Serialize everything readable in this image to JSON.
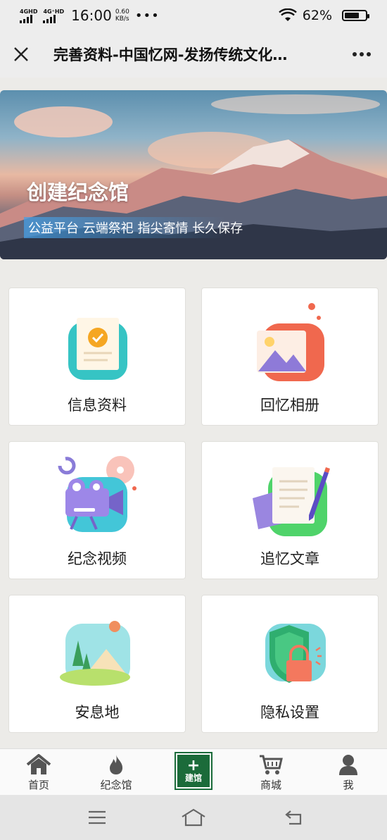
{
  "status_bar": {
    "signal1_label": "4GHD",
    "signal2_label": "4G⁺HD",
    "time": "16:00",
    "speed_value": "0.60",
    "speed_unit": "KB/s",
    "battery": "62%",
    "battery_level": 0.62
  },
  "header": {
    "title": "完善资料-中国忆网-发扬传统文化…"
  },
  "banner": {
    "title": "创建纪念馆",
    "subtitle": "公益平台 云端祭祀 指尖寄情 长久保存"
  },
  "grid": {
    "items": [
      {
        "label": "信息资料",
        "icon": "certificate-icon"
      },
      {
        "label": "回忆相册",
        "icon": "photo-album-icon"
      },
      {
        "label": "纪念视频",
        "icon": "video-camera-icon"
      },
      {
        "label": "追忆文章",
        "icon": "article-pen-icon"
      },
      {
        "label": "安息地",
        "icon": "landscape-icon"
      },
      {
        "label": "隐私设置",
        "icon": "shield-lock-icon"
      }
    ]
  },
  "bottom_nav": {
    "items": [
      {
        "label": "首页",
        "icon": "home-icon"
      },
      {
        "label": "纪念馆",
        "icon": "flame-icon"
      },
      {
        "label": "建馆",
        "icon": "plus-icon"
      },
      {
        "label": "商城",
        "icon": "cart-icon"
      },
      {
        "label": "我",
        "icon": "user-icon"
      }
    ],
    "build_color": "#1b6b3a"
  },
  "colors": {
    "accent_green": "#1b6b3a"
  }
}
